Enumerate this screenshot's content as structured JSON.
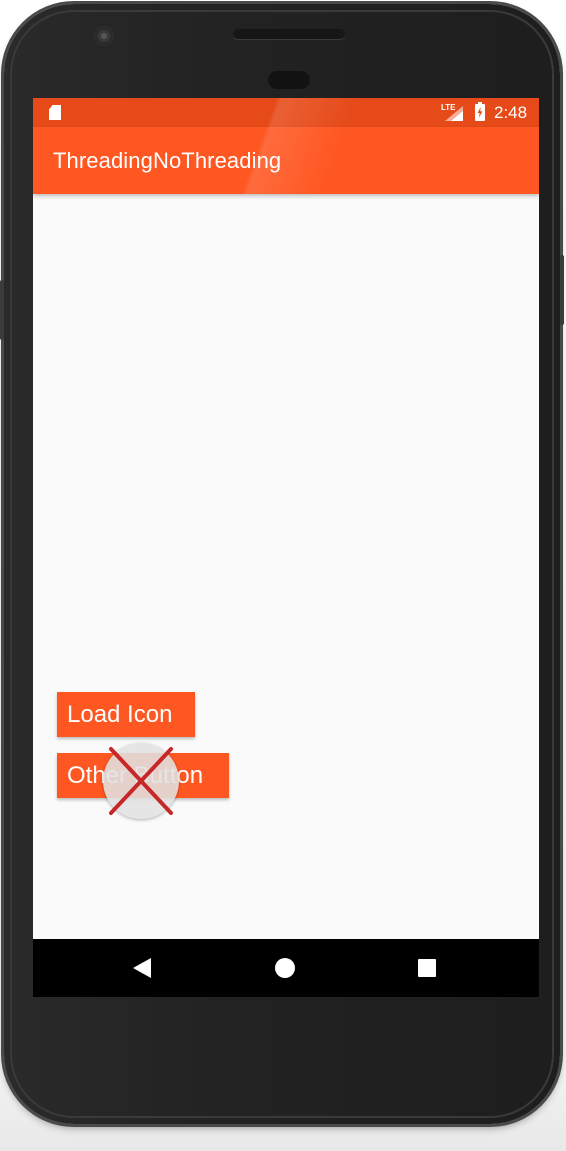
{
  "status_bar": {
    "network_label": "LTE",
    "time": "2:48",
    "icons": [
      "sd-card-icon",
      "signal-icon",
      "battery-charging-icon"
    ]
  },
  "app_bar": {
    "title": "ThreadingNoThreading"
  },
  "main": {
    "load_icon_button": "Load Icon",
    "other_button": "Other Button"
  },
  "touch_indicator": {
    "icon": "x-mark-icon"
  },
  "nav_bar": {
    "icons": [
      "back-icon",
      "home-icon",
      "recents-icon"
    ]
  },
  "colors": {
    "primary": "#ff5722",
    "primary_dark": "#e64a19",
    "background": "#fafafa",
    "x_mark": "#c62828"
  }
}
